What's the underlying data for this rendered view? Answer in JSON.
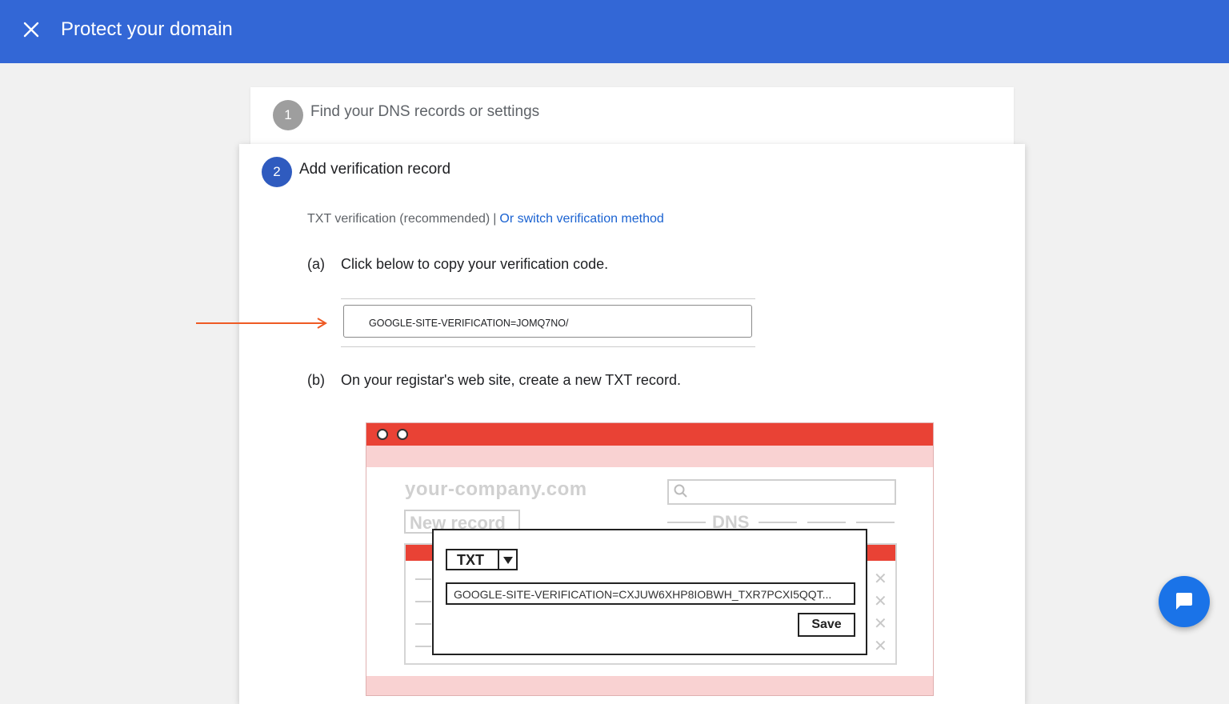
{
  "header": {
    "title": "Protect your domain",
    "close_icon": "close-icon",
    "bg_color": "#3367d6"
  },
  "steps": [
    {
      "number": "1",
      "label": "Find your DNS records or settings"
    },
    {
      "number": "2",
      "label": "Add verification record"
    }
  ],
  "method": {
    "current": "TXT verification (recommended)",
    "separator": "|",
    "switch_link": "Or switch verification method"
  },
  "substep_a": {
    "letter": "(a)",
    "text": "Click below to copy your verification code."
  },
  "code_field": {
    "value": "GOOGLE-SITE-VERIFICATION=JOMQ7NO/"
  },
  "substep_b": {
    "letter": "(b)",
    "text": "On your registar's web site, create a new TXT record."
  },
  "illustration": {
    "domain": "your-company.com",
    "new_record": "New record",
    "dns": "DNS",
    "record_type": "TXT",
    "record_value": "GOOGLE-SITE-VERIFICATION=CXJUW6XHP8IOBWH_TXR7PCXI5QQT...",
    "save": "Save",
    "x_mark": "✕"
  },
  "fab": {
    "icon": "chat-icon"
  }
}
